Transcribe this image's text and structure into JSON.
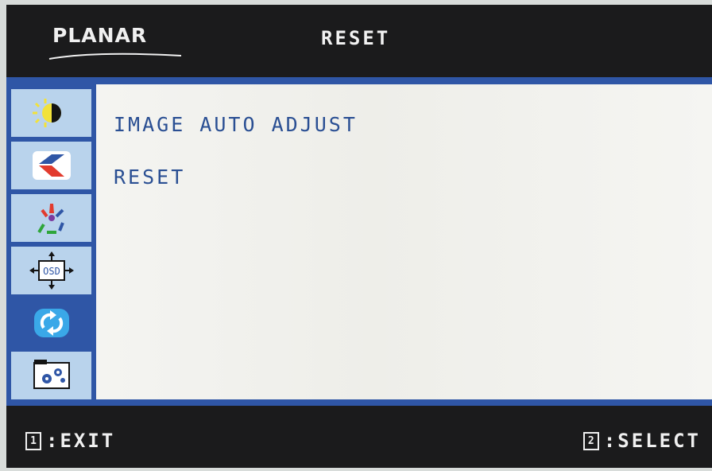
{
  "brand": "PLANAR",
  "title": "RESET",
  "menu": {
    "items": [
      {
        "label": "IMAGE AUTO ADJUST"
      },
      {
        "label": "RESET"
      }
    ]
  },
  "sidebar": {
    "icons": [
      {
        "name": "brightness-contrast-icon"
      },
      {
        "name": "image-geometry-icon"
      },
      {
        "name": "color-icon"
      },
      {
        "name": "osd-settings-icon",
        "text": "OSD"
      },
      {
        "name": "reset-icon",
        "active": true
      },
      {
        "name": "setup-gears-icon"
      }
    ]
  },
  "footer": {
    "exit_key": "1",
    "exit_label": ":EXIT",
    "select_key": "2",
    "select_label": ":SELECT"
  },
  "colors": {
    "frame": "#1b1b1c",
    "accent_blue": "#2f56a6",
    "sidebar_item": "#b9d3ec",
    "menu_text": "#2a4f93",
    "panel": "#f2f2ee"
  }
}
